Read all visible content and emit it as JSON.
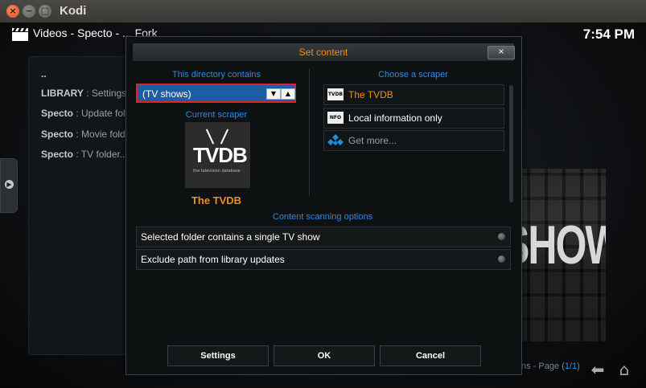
{
  "window": {
    "title": "Kodi",
    "close_glyph": "×",
    "min_glyph": "−",
    "max_glyph": "□"
  },
  "header": {
    "breadcrumb": "Videos  - Specto - ... Fork",
    "clock": "7:54 PM"
  },
  "background_list": {
    "rows": [
      {
        "prefix": "..",
        "text": ""
      },
      {
        "prefix": "LIBRARY",
        "text": " : Settings"
      },
      {
        "prefix": "Specto",
        "text": " : Update fol"
      },
      {
        "prefix": "Specto",
        "text": " : Movie fold"
      },
      {
        "prefix": "Specto",
        "text": " : TV folder.."
      }
    ]
  },
  "poster": {
    "text": "SHOWS"
  },
  "footer": {
    "page_prefix": "ns - Page (",
    "page_value": "1/1",
    "page_suffix": ")"
  },
  "dialog": {
    "title": "Set content",
    "close_label": "×",
    "directory_label": "This directory contains",
    "directory_value": "(TV shows)",
    "current_scraper_label": "Current scraper",
    "current_scraper_name": "The TVDB",
    "logo_text": "TVDB",
    "logo_sub": "the television database",
    "choose_scraper_label": "Choose a scraper",
    "scrapers": [
      {
        "icon": "TVDB",
        "label": "The TVDB",
        "color": "#f08f1b"
      },
      {
        "icon": "NFO",
        "label": "Local information only",
        "color": "#ffffff"
      },
      {
        "icon": "",
        "label": "Get more...",
        "color": "#9aa0a4"
      }
    ],
    "scanning_label": "Content scanning options",
    "options": [
      {
        "label": "Selected folder contains a single TV show"
      },
      {
        "label": "Exclude path from library updates"
      }
    ],
    "buttons": {
      "settings": "Settings",
      "ok": "OK",
      "cancel": "Cancel"
    }
  },
  "colors": {
    "accent_orange": "#f08f1b",
    "accent_blue": "#2e8be0",
    "select_blue": "#1d5ea2",
    "focus_red": "#e0202a"
  }
}
